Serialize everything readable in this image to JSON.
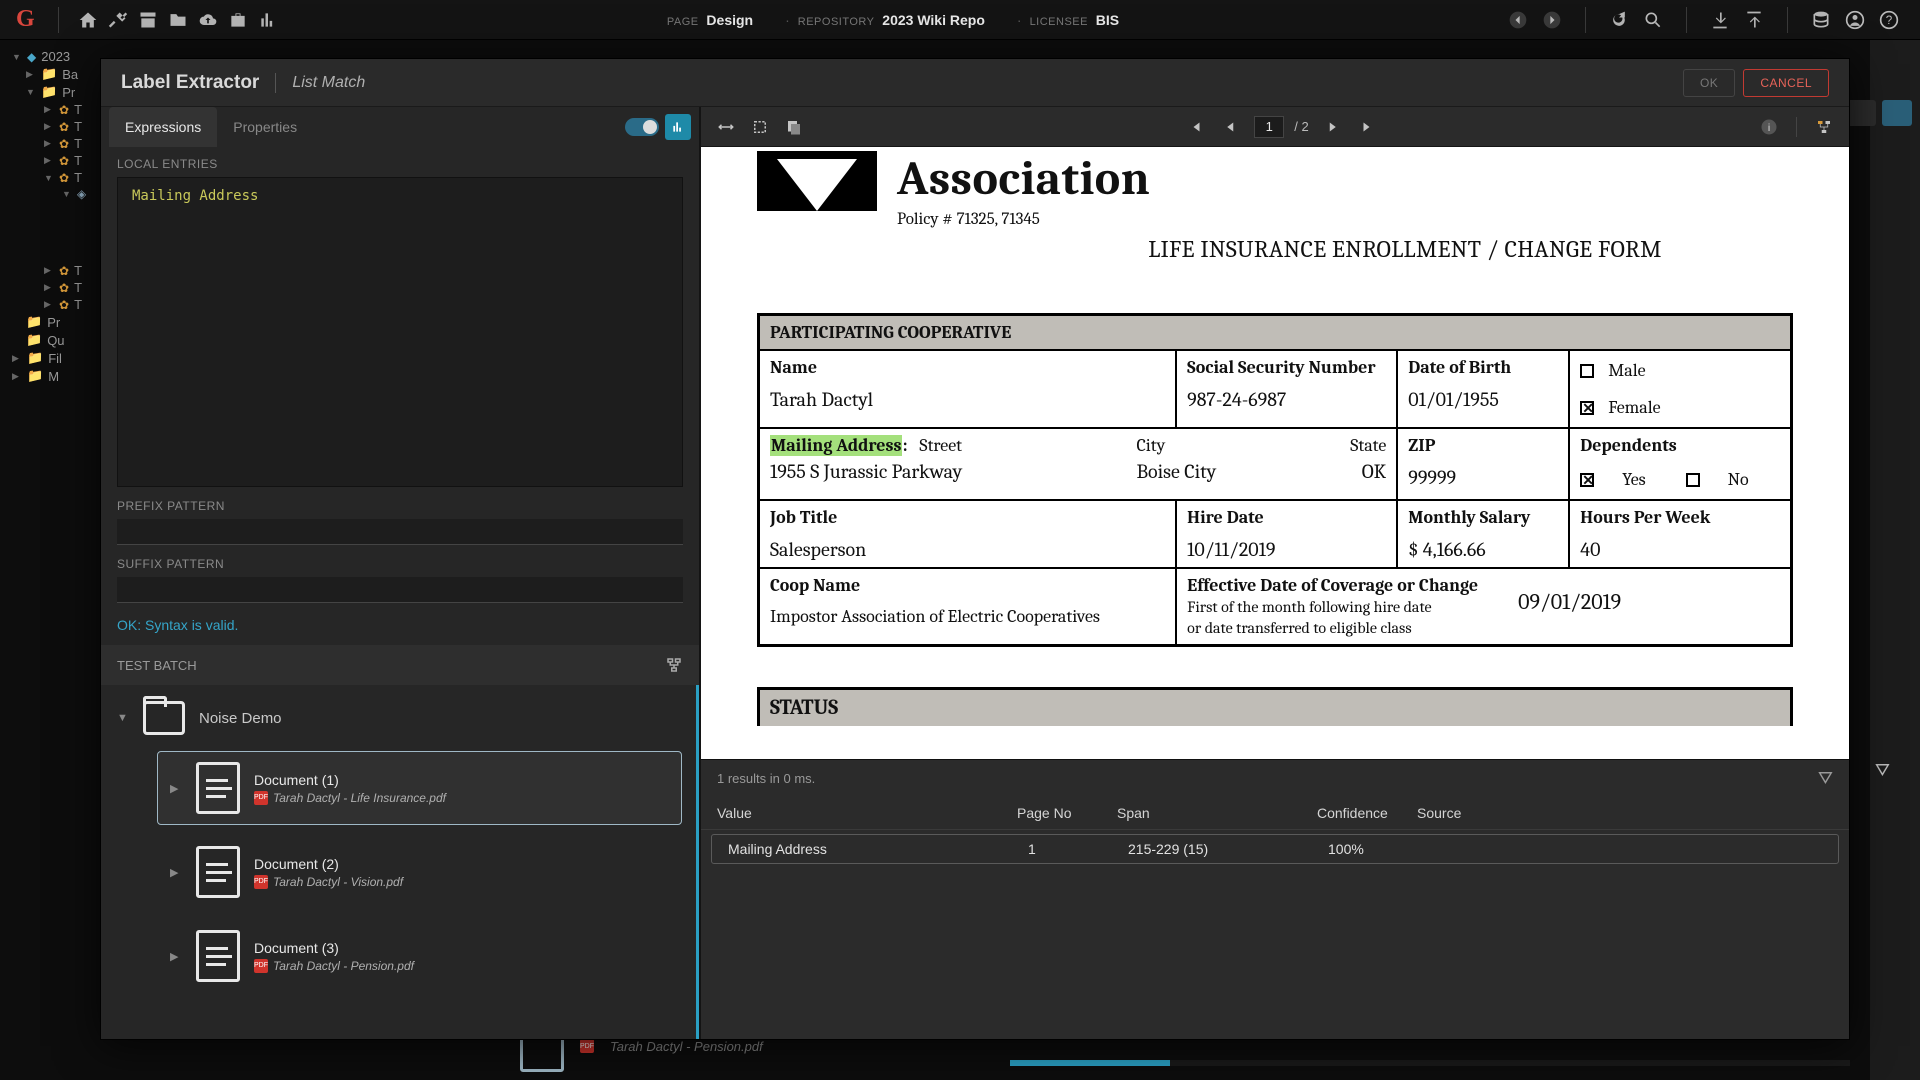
{
  "app": {
    "page_label": "PAGE",
    "page_value": "Design",
    "repo_label": "REPOSITORY",
    "repo_value": "2023 Wiki Repo",
    "licensee_label": "LICENSEE",
    "licensee_value": "BIS"
  },
  "modal": {
    "title": "Label Extractor",
    "subtitle": "List Match",
    "ok": "OK",
    "cancel": "CANCEL"
  },
  "left": {
    "tabs": {
      "expressions": "Expressions",
      "properties": "Properties"
    },
    "local_entries_label": "LOCAL ENTRIES",
    "entries": [
      "Mailing Address"
    ],
    "prefix_label": "PREFIX PATTERN",
    "suffix_label": "SUFFIX PATTERN",
    "syntax_status": "OK: Syntax is valid.",
    "test_batch_label": "TEST BATCH",
    "batch": {
      "folder": "Noise Demo",
      "docs": [
        {
          "title": "Document (1)",
          "file": "Tarah Dactyl - Life Insurance.pdf",
          "selected": true
        },
        {
          "title": "Document (2)",
          "file": "Tarah Dactyl - Vision.pdf",
          "selected": false
        },
        {
          "title": "Document (3)",
          "file": "Tarah Dactyl - Pension.pdf",
          "selected": false
        }
      ]
    }
  },
  "preview": {
    "page_current": "1",
    "page_total": "/ 2"
  },
  "doc": {
    "association": "Association",
    "policy": "Policy # 71325, 71345",
    "form_title": "LIFE INSURANCE ENROLLMENT / CHANGE FORM",
    "section1": "PARTICIPATING COOPERATIVE",
    "name_label": "Name",
    "name_value": "Tarah Dactyl",
    "ssn_label": "Social Security Number",
    "ssn_value": "987-24-6987",
    "dob_label": "Date of Birth",
    "dob_value": "01/01/1955",
    "male": "Male",
    "female": "Female",
    "mailing_label": "Mailing Address",
    "mailing_colon": ":",
    "street_label": "Street",
    "street_value": "1955 S Jurassic Parkway",
    "city_label": "City",
    "city_value": "Boise City",
    "state_label": "State",
    "state_value": "OK",
    "zip_label": "ZIP",
    "zip_value": "99999",
    "dependents_label": "Dependents",
    "yes": "Yes",
    "no": "No",
    "jobtitle_label": "Job Title",
    "jobtitle_value": "Salesperson",
    "hiredate_label": "Hire Date",
    "hiredate_value": "10/11/2019",
    "salary_label": "Monthly Salary",
    "salary_value": "$  4,166.66",
    "hours_label": "Hours Per Week",
    "hours_value": "40",
    "coop_label": "Coop Name",
    "coop_value": "Impostor Association of Electric Cooperatives",
    "eff_label": "Effective Date of Coverage or Change",
    "eff_note1": "First of the month following hire date",
    "eff_note2": "or date transferred to eligible class",
    "eff_value": "09/01/2019",
    "status_label": "STATUS"
  },
  "results": {
    "summary": "1 results in 0 ms.",
    "cols": {
      "value": "Value",
      "page": "Page No",
      "span": "Span",
      "conf": "Confidence",
      "src": "Source"
    },
    "rows": [
      {
        "value": "Mailing Address",
        "page": "1",
        "span": "215-229 (15)",
        "conf": "100%",
        "src": ""
      }
    ]
  },
  "bg": {
    "tree_root": "2023",
    "items": [
      "Ba",
      "Pr",
      "T",
      "T",
      "T",
      "T",
      "T",
      "",
      "",
      "T",
      "T",
      "T",
      "Pr",
      "Qu",
      "Fil",
      "M"
    ],
    "bottom_doc": "Tarah Dactyl - Pension.pdf"
  }
}
